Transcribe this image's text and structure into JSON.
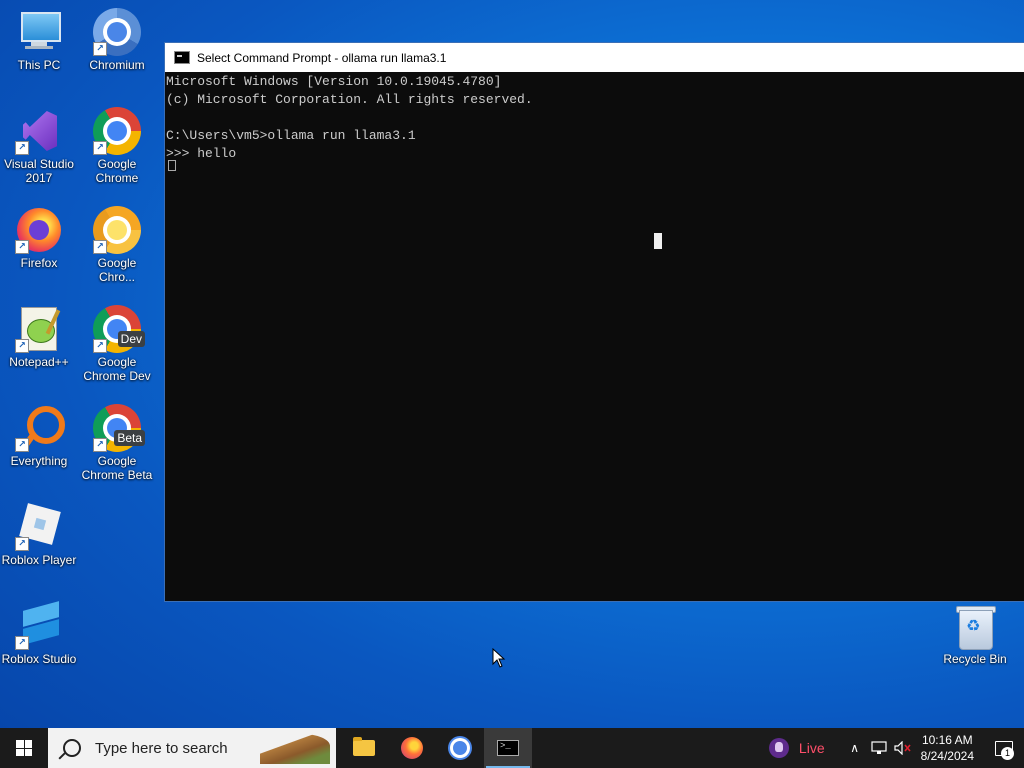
{
  "desktop": {
    "icons_left": [
      {
        "label": "This PC",
        "icon": "this-pc-icon"
      },
      {
        "label": "Visual Studio 2017",
        "icon": "visual-studio-icon"
      },
      {
        "label": "Firefox",
        "icon": "firefox-icon"
      },
      {
        "label": "Notepad++",
        "icon": "notepad-plus-plus-icon"
      },
      {
        "label": "Everything",
        "icon": "everything-search-icon"
      },
      {
        "label": "Roblox Player",
        "icon": "roblox-player-icon"
      },
      {
        "label": "Roblox Studio",
        "icon": "roblox-studio-icon"
      }
    ],
    "icons_right": [
      {
        "label": "Chromium",
        "icon": "chromium-icon"
      },
      {
        "label": "Google Chrome",
        "icon": "chrome-icon"
      },
      {
        "label": "Google Chro...",
        "icon": "chrome-canary-icon"
      },
      {
        "label": "Google Chrome Dev",
        "icon": "chrome-dev-icon",
        "badge": "Dev"
      },
      {
        "label": "Google Chrome Beta",
        "icon": "chrome-beta-icon",
        "badge": "Beta"
      }
    ],
    "recycle_bin": {
      "label": "Recycle Bin"
    }
  },
  "cmd_window": {
    "title": "Select Command Prompt - ollama  run llama3.1",
    "lines": [
      "Microsoft Windows [Version 10.0.19045.4780]",
      "(c) Microsoft Corporation. All rights reserved.",
      "",
      "C:\\Users\\vm5>ollama run llama3.1",
      ">>> hello"
    ]
  },
  "taskbar": {
    "search_placeholder": "Type here to search",
    "apps": [
      "file-explorer-icon",
      "firefox-icon",
      "chromium-icon",
      "command-prompt-icon"
    ],
    "tray": {
      "live_label": "Live",
      "time": "10:16 AM",
      "date": "8/24/2024",
      "notification_count": "1"
    }
  }
}
